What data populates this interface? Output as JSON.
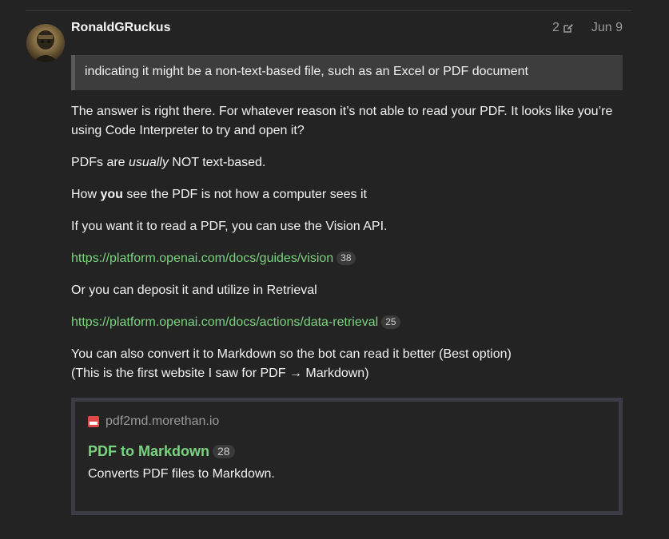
{
  "post": {
    "author": "RonaldGRuckus",
    "edit_count": "2",
    "date": "Jun 9",
    "quote": "indicating it might be a non-text-based file, such as an Excel or PDF document",
    "p1": "The answer is right there. For whatever reason it’s not able to read your PDF. It looks like you’re using Code Interpreter to try and open it?",
    "p2": {
      "pre": "PDFs are ",
      "em": "usually",
      "post": " NOT text-based."
    },
    "p3": {
      "pre": "How ",
      "strong": "you",
      "post": " see the PDF is not how a computer sees it"
    },
    "p4": "If you want it to read a PDF, you can use the Vision API.",
    "link1": {
      "text": "https://platform.openai.com/docs/guides/vision",
      "clicks": "38"
    },
    "p5": "Or you can deposit it and utilize in Retrieval",
    "link2": {
      "text": "https://platform.openai.com/docs/actions/data-retrieval",
      "clicks": "25"
    },
    "p6_line1": "You can also convert it to Markdown so the bot can read it better (Best option)",
    "p6_line2": "(This is the first website I saw for PDF → Markdown)",
    "onebox": {
      "source": "pdf2md.morethan.io",
      "title": "PDF to Markdown",
      "clicks": "28",
      "description": "Converts PDF files to Markdown."
    }
  },
  "colors": {
    "link": "#7ad37e",
    "background": "#232323"
  },
  "icons": {
    "edit": "pencil-edit-icon",
    "favicon": "pdf-favicon-icon"
  }
}
